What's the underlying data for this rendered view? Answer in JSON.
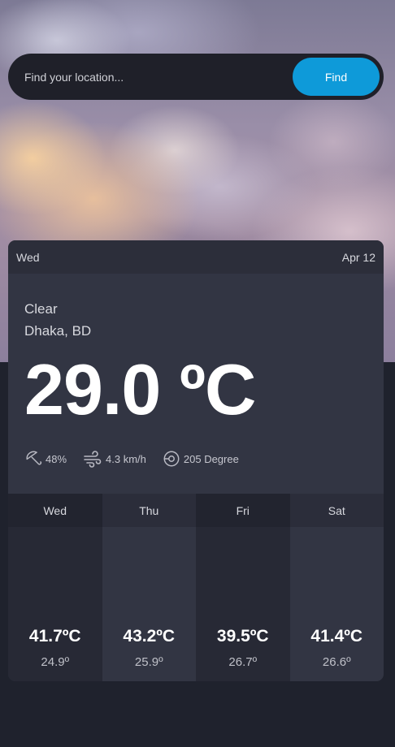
{
  "search": {
    "placeholder": "Find your location...",
    "button_label": "Find"
  },
  "current": {
    "day": "Wed",
    "date": "Apr 12",
    "condition": "Clear",
    "location": "Dhaka, BD",
    "temperature": "29.0 ºC",
    "humidity": "48%",
    "wind": "4.3 km/h",
    "wind_direction": "205 Degree"
  },
  "forecast": [
    {
      "day": "Wed",
      "max": "41.7ºC",
      "min": "24.9º"
    },
    {
      "day": "Thu",
      "max": "43.2ºC",
      "min": "25.9º"
    },
    {
      "day": "Fri",
      "max": "39.5ºC",
      "min": "26.7º"
    },
    {
      "day": "Sat",
      "max": "41.4ºC",
      "min": "26.6º"
    }
  ],
  "icons": {
    "humidity": "umbrella-icon",
    "wind": "wind-icon",
    "direction": "compass-icon"
  },
  "colors": {
    "accent": "#0e9ad9",
    "card": "#323543",
    "background": "#1f222d"
  }
}
